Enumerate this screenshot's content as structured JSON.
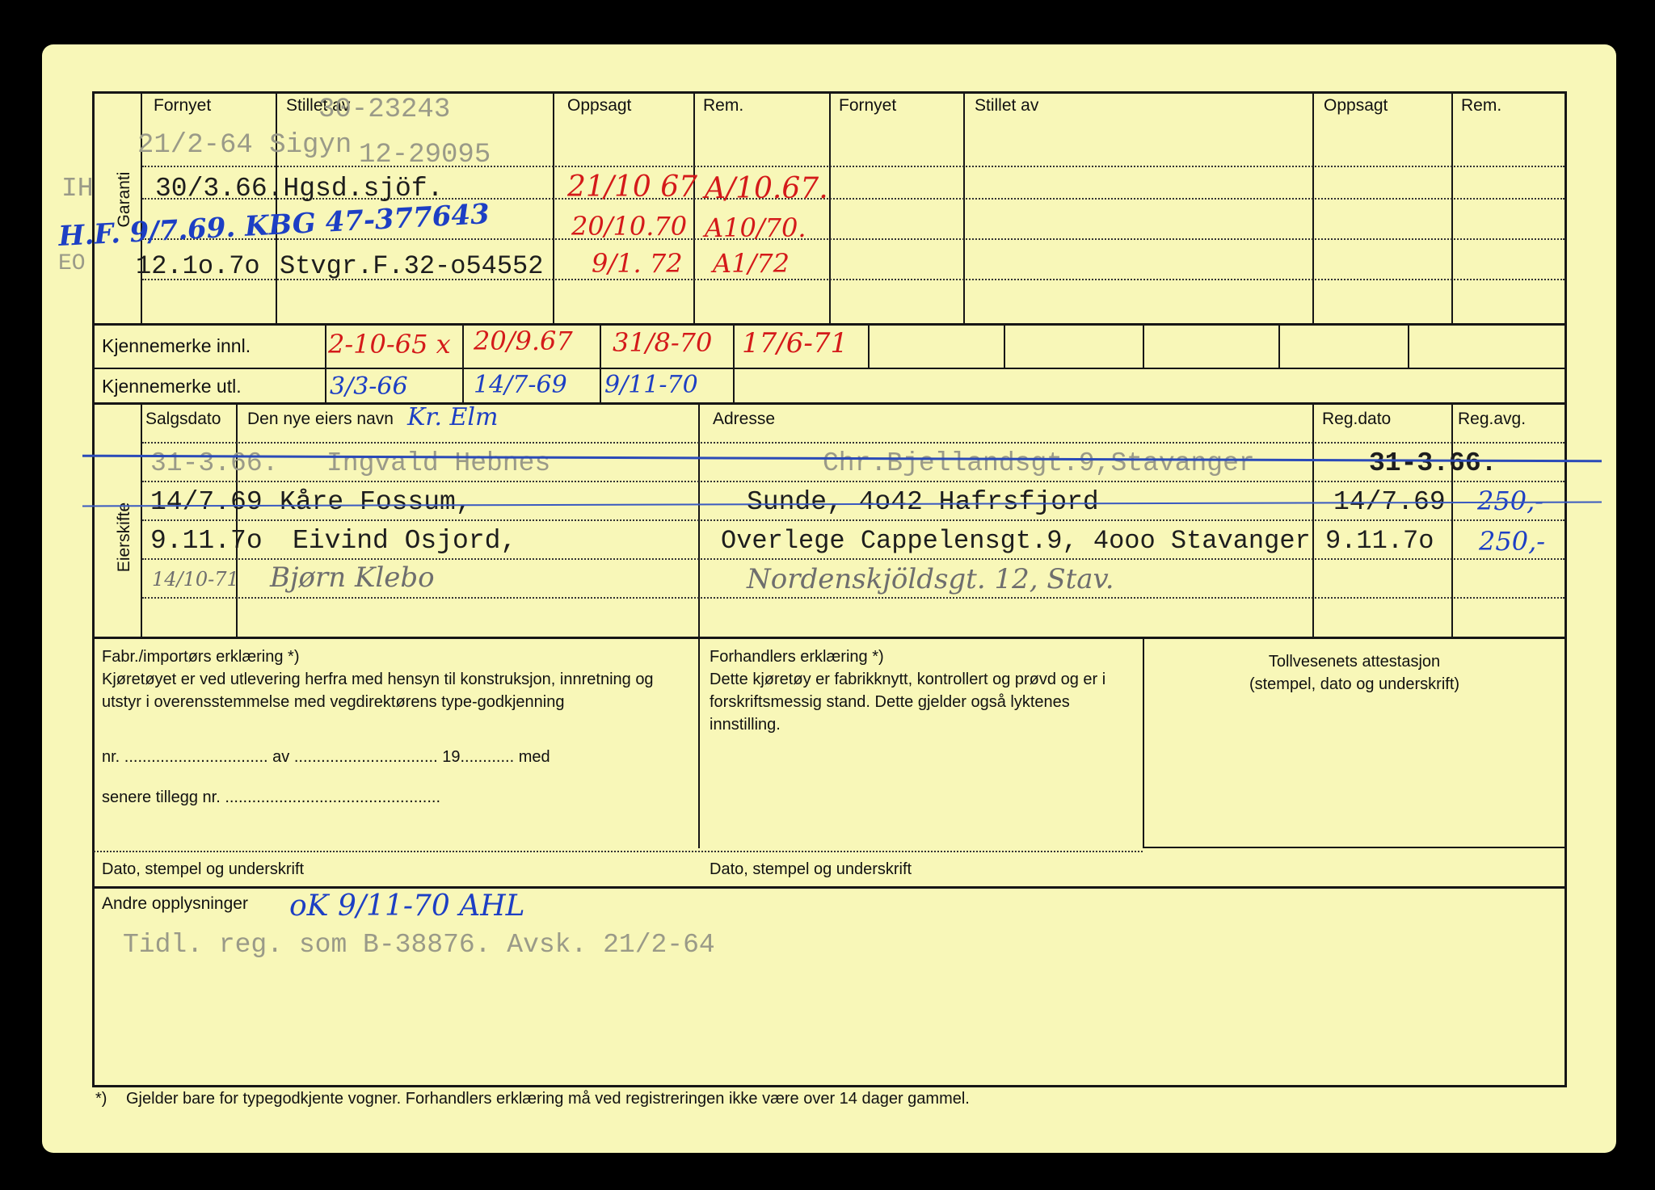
{
  "garanti": {
    "side_label": "Garanti",
    "headers_left": [
      "Fornyet",
      "Stillet av",
      "Oppsagt",
      "Rem."
    ],
    "headers_right": [
      "Fornyet",
      "Stillet av",
      "Oppsagt",
      "Rem."
    ],
    "margin_codes": [
      "IH",
      "EO"
    ],
    "typed": {
      "number_1": "30-23243",
      "row1": "21/2-64 Sigyn",
      "number_2": "12-29095",
      "row2": "30/3.66.Hgsd.sjöf.",
      "row4_date": "12.1o.7o",
      "row4_insurer": "Stvgr.F.32-o54552"
    },
    "handwritten": {
      "blue_row": "H.F. 9/7.69. KBG 47-377643",
      "oppsagt": [
        "21/10 67",
        "20/10.70",
        "9/1. 72"
      ],
      "rem": [
        "A/10.67.",
        "A10/70.",
        "A1/72"
      ]
    }
  },
  "kjennemerke": {
    "innl_label": "Kjennemerke innl.",
    "utl_label": "Kjennemerke utl.",
    "innl_values": [
      "2-10-65 x",
      "20/9.67",
      "31/8-70",
      "17/6-71"
    ],
    "utl_values": [
      "3/3-66",
      "14/7-69",
      "9/11-70"
    ]
  },
  "eierskifte": {
    "side_label": "Eierskifte",
    "headers": [
      "Salgsdato",
      "Den nye eiers navn",
      "Adresse",
      "Reg.dato",
      "Reg.avg."
    ],
    "header_annotation": "Kr. Elm",
    "rows": [
      {
        "date": "31-3.66.",
        "name": "Ingvald Hebnes",
        "address": "Chr.Bjellandsgt.9,Stavanger",
        "reg_dato": "31-3.66.",
        "reg_avg": ""
      },
      {
        "date": "14/7.69",
        "name": "Kåre Fossum,",
        "address": "Sunde, 4o42 Hafrsfjord",
        "reg_dato": "14/7.69",
        "reg_avg": "250,-"
      },
      {
        "date": "9.11.7o",
        "name": "Eivind Osjord,",
        "address": "Overlege Cappelensgt.9, 4ooo Stavanger",
        "reg_dato": "9.11.7o",
        "reg_avg": "250,-"
      },
      {
        "date": "14/10-71",
        "name": "Bjørn Klebo",
        "address": "Nordenskjöldsgt. 12, Stav.",
        "reg_dato": "",
        "reg_avg": ""
      }
    ]
  },
  "erklaering": {
    "fabr_title": "Fabr./importørs erklæring *)",
    "fabr_text": "Kjøretøyet er ved utlevering herfra med hensyn til konstruksjon, innretning og utstyr i overensstemmelse med vegdirektørens type-godkjenning",
    "fabr_line1": "nr. ................................ av ................................ 19............ med",
    "fabr_line2": "senere tillegg nr. ................................................",
    "dato_label_1": "Dato, stempel og underskrift",
    "forh_title": "Forhandlers erklæring *)",
    "forh_text": "Dette kjøretøy er fabrikknytt, kontrollert og prøvd og er i forskriftsmessig stand. Dette gjelder også lyktenes innstilling.",
    "dato_label_2": "Dato, stempel og underskrift",
    "toll_title": "Tollvesenets attestasjon",
    "toll_sub": "(stempel, dato og underskrift)"
  },
  "andre": {
    "label": "Andre opplysninger",
    "handwritten": "oK 9/11-70 AHL",
    "typed": "Tidl. reg. som B-38876. Avsk. 21/2-64"
  },
  "footnote": {
    "mark": "*)",
    "text": "Gjelder bare for typegodkjente vogner.  Forhandlers erklæring må ved registreringen ikke være over 14 dager gammel."
  },
  "colors": {
    "card": "#f8f7b8",
    "ink_red": "#d41a1a",
    "ink_blue": "#1d3fc4",
    "typewriter": "#1d1d1d"
  }
}
